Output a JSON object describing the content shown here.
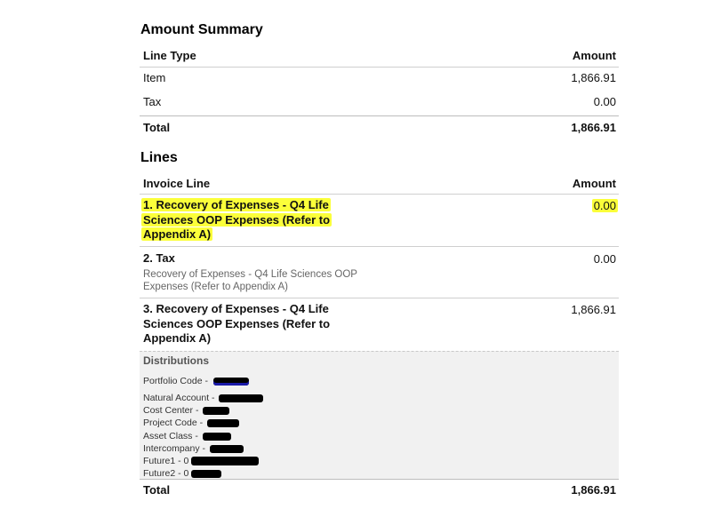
{
  "amount_summary": {
    "heading": "Amount Summary",
    "col_type": "Line Type",
    "col_amount": "Amount",
    "rows": [
      {
        "type": "Item",
        "amount": "1,866.91"
      },
      {
        "type": "Tax",
        "amount": "0.00"
      }
    ],
    "total_label": "Total",
    "total_amount": "1,866.91"
  },
  "lines": {
    "heading": "Lines",
    "col_line": "Invoice Line",
    "col_amount": "Amount",
    "items": [
      {
        "title": "1. Recovery of Expenses - Q4 Life Sciences OOP Expenses (Refer to Appendix A)",
        "amount": "0.00",
        "subtitle": ""
      },
      {
        "title": "2. Tax",
        "amount": "0.00",
        "subtitle": "Recovery of Expenses - Q4 Life Sciences OOP Expenses (Refer to Appendix A)"
      },
      {
        "title": "3. Recovery of Expenses - Q4 Life Sciences OOP Expenses (Refer to Appendix A)",
        "amount": "1,866.91",
        "subtitle": ""
      }
    ],
    "distributions": {
      "heading": "Distributions",
      "items": [
        {
          "label": "Portfolio Code -"
        },
        {
          "label": "Natural Account -"
        },
        {
          "label": "Cost Center -"
        },
        {
          "label": "Project Code -"
        },
        {
          "label": "Asset Class -"
        },
        {
          "label": "Intercompany -"
        },
        {
          "label": "Future1 - 0"
        },
        {
          "label": "Future2 - 0"
        }
      ]
    },
    "total_label": "Total",
    "total_amount": "1,866.91"
  },
  "colors": {
    "highlight": "#fbff3a",
    "rule": "#cfcfcf",
    "distribution_bg": "#f1f1f1",
    "redaction": "#000000",
    "redaction_blue_tint": "#1a1aa8"
  }
}
